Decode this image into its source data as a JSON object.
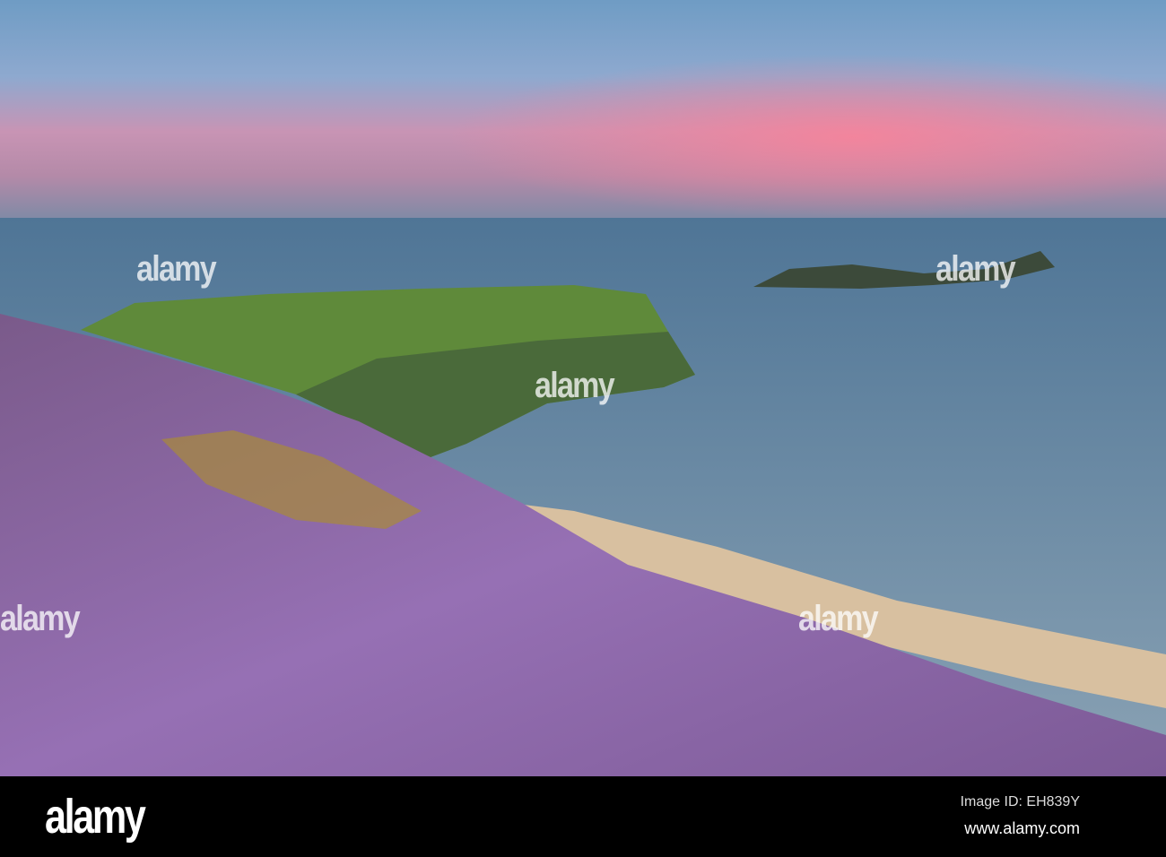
{
  "photo": {
    "subject": "heather-covered hillside above a beach and sea headland at sunset",
    "colors": {
      "sky_top": "#6f9cc4",
      "sky_pink": "#f08aa0",
      "sea": "#5c7e98",
      "heather": "#8a63a8",
      "grass": "#5f8a3a",
      "sand": "#d8c0a0"
    }
  },
  "watermark": {
    "text": "alamy"
  },
  "footer": {
    "logo": "alamy",
    "image_id": "Image ID: EH839Y",
    "website": "www.alamy.com"
  }
}
